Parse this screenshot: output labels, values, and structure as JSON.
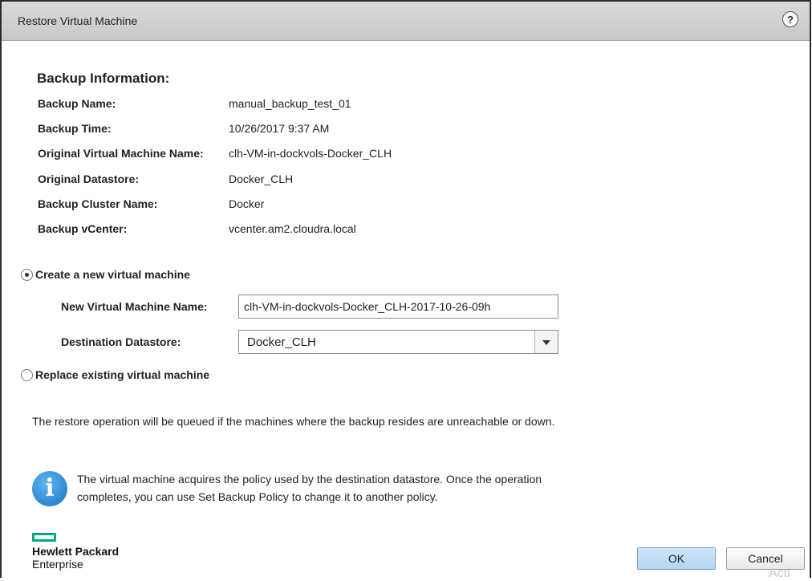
{
  "dialog": {
    "title": "Restore Virtual Machine",
    "help_glyph": "?"
  },
  "backup_info": {
    "heading": "Backup Information:",
    "rows": [
      {
        "label": "Backup Name:",
        "value": "manual_backup_test_01"
      },
      {
        "label": "Backup Time:",
        "value": "10/26/2017 9:37 AM"
      },
      {
        "label": "Original Virtual Machine Name:",
        "value": "clh-VM-in-dockvols-Docker_CLH"
      },
      {
        "label": "Original Datastore:",
        "value": "Docker_CLH"
      },
      {
        "label": "Backup Cluster Name:",
        "value": "Docker"
      },
      {
        "label": "Backup vCenter:",
        "value": "vcenter.am2.cloudra.local"
      }
    ]
  },
  "options": {
    "create_new_label": "Create a new virtual machine",
    "create_new_selected": true,
    "new_vm_name_label": "New Virtual Machine Name:",
    "new_vm_name_value": "clh-VM-in-dockvols-Docker_CLH-2017-10-26-09h",
    "destination_label": "Destination Datastore:",
    "destination_value": "Docker_CLH",
    "replace_label": "Replace existing virtual machine",
    "replace_selected": false
  },
  "notice_text": "The restore operation will be queued if the machines where the backup resides are unreachable or down.",
  "info_message": "The virtual machine acquires the policy used by the destination datastore. Once the operation completes, you can use Set Backup Policy to change it to another policy.",
  "info_icon_glyph": "i",
  "logo": {
    "line1": "Hewlett Packard",
    "line2": "Enterprise",
    "color": "#01a982"
  },
  "buttons": {
    "ok": "OK",
    "cancel": "Cancel"
  },
  "watermark": "Acti"
}
